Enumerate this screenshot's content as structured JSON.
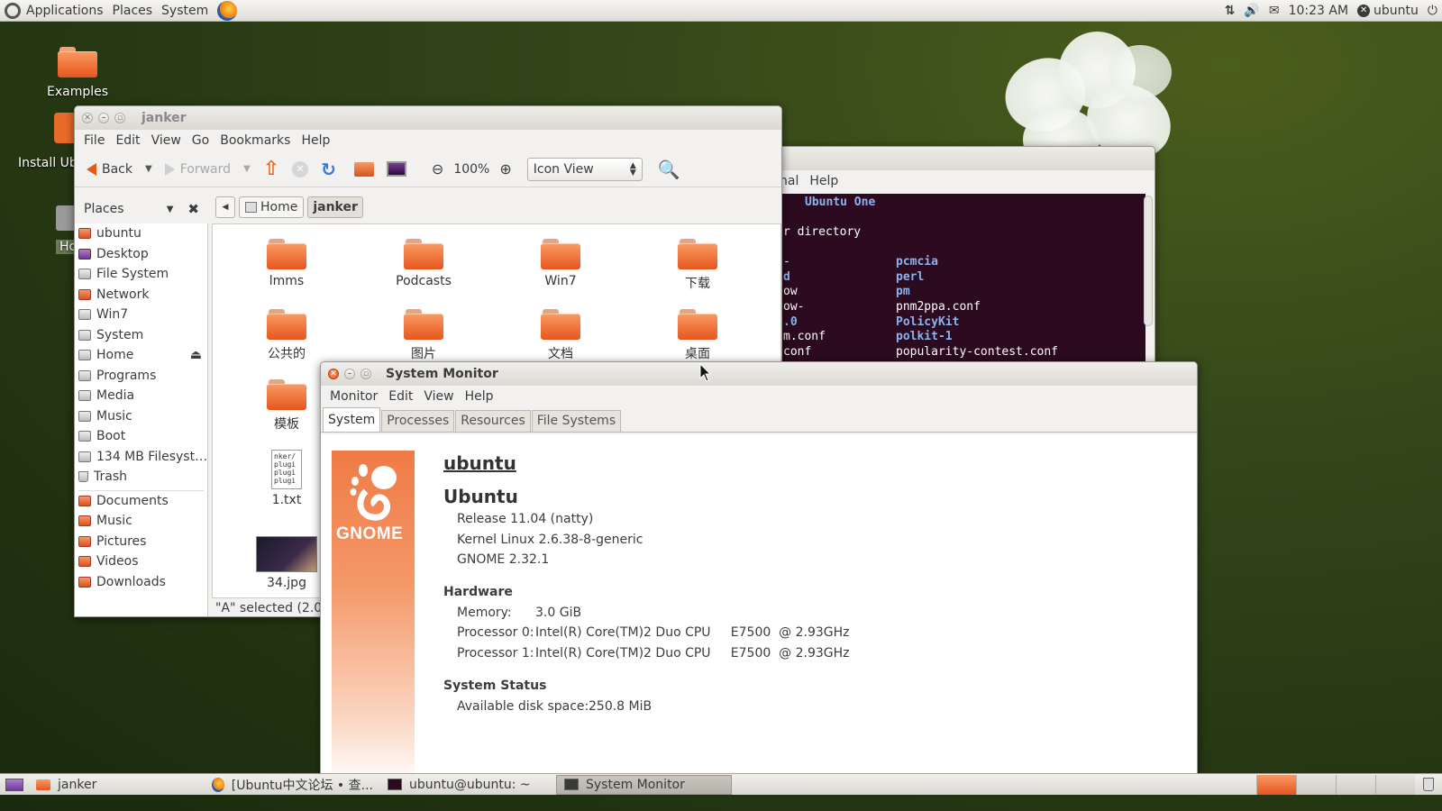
{
  "top_panel": {
    "menus": [
      "Applications",
      "Places",
      "System"
    ],
    "clock": "10:23 AM",
    "user": "ubuntu"
  },
  "desktop": {
    "icons": [
      {
        "label": "Examples"
      },
      {
        "label": "Install Ub"
      },
      {
        "label": "Ho"
      }
    ]
  },
  "nautilus": {
    "title": "janker",
    "menu": [
      "File",
      "Edit",
      "View",
      "Go",
      "Bookmarks",
      "Help"
    ],
    "toolbar": {
      "back": "Back",
      "forward": "Forward",
      "zoom": "100%",
      "view_mode": "Icon View"
    },
    "places_label": "Places",
    "breadcrumbs": [
      "Home",
      "janker"
    ],
    "sidebar": [
      "ubuntu",
      "Desktop",
      "File System",
      "Network",
      "Win7",
      "System",
      "Home",
      "Programs",
      "Media",
      "Music",
      "Boot",
      "134 MB Filesyst…",
      "Trash"
    ],
    "bookmarks": [
      "Documents",
      "Music",
      "Pictures",
      "Videos",
      "Downloads"
    ],
    "files": [
      "lmms",
      "Podcasts",
      "Win7",
      "下载",
      "公共的",
      "图片",
      "文档",
      "桌面",
      "模板",
      "1.txt",
      "34.jpg"
    ],
    "txt_preview": "nker/\nplugi\nplugi\nplugi",
    "status": "\"A\" selected (2.0 K"
  },
  "terminal": {
    "menu": [
      "nal",
      "Help"
    ],
    "lines": [
      {
        "left": "",
        "right": "Ubuntu One"
      },
      {
        "left": "r directory",
        "right": ""
      },
      {
        "left": "-",
        "right": "pcmcia"
      },
      {
        "left": "d",
        "right": "perl"
      },
      {
        "left": "ow",
        "right": "pm"
      },
      {
        "left": "ow-",
        "right": "pnm2ppa.conf"
      },
      {
        "left": ".0",
        "right": "PolicyKit"
      },
      {
        "left": "m.conf",
        "right": "polkit-1"
      },
      {
        "left": "conf",
        "right": "popularity-contest.conf"
      }
    ]
  },
  "system_monitor": {
    "title": "System Monitor",
    "menu": [
      "Monitor",
      "Edit",
      "View",
      "Help"
    ],
    "tabs": [
      "System",
      "Processes",
      "Resources",
      "File Systems"
    ],
    "logo_text": "GNOME",
    "hostname": "ubuntu",
    "distro": "Ubuntu",
    "release": "Release 11.04 (natty)",
    "kernel": "Kernel Linux 2.6.38-8-generic",
    "gnome": "GNOME 2.32.1",
    "hardware_label": "Hardware",
    "memory_label": "Memory:",
    "memory_value": "3.0 GiB",
    "proc0_label": "Processor 0:",
    "proc0_value": "Intel(R) Core(TM)2 Duo CPU     E7500  @ 2.93GHz",
    "proc1_label": "Processor 1:",
    "proc1_value": "Intel(R) Core(TM)2 Duo CPU     E7500  @ 2.93GHz",
    "status_label": "System Status",
    "disk_label": "Available disk space:",
    "disk_value": "250.8 MiB"
  },
  "taskbar": [
    "janker",
    "[Ubuntu中文论坛 • 查...",
    "ubuntu@ubuntu: ~",
    "System Monitor"
  ]
}
